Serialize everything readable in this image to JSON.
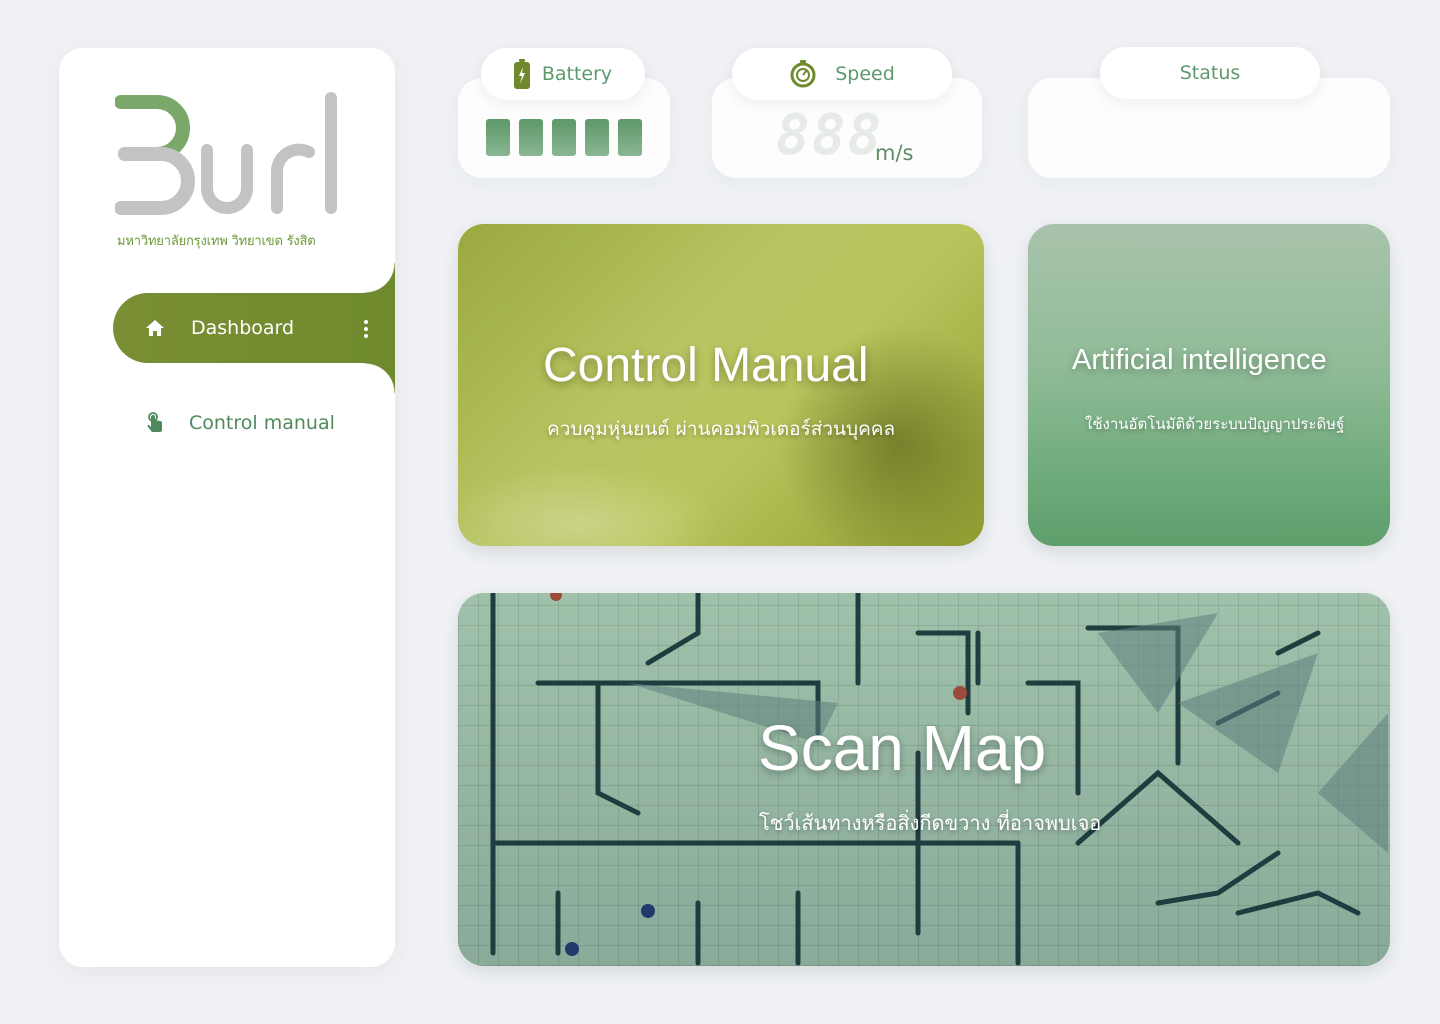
{
  "sidebar": {
    "university": "มหาวิทยาลัยกรุงเทพ วิทยาเขต รังสิต",
    "logo_icon": "burl-logo",
    "items": [
      {
        "label": "Dashboard",
        "icon": "home-icon",
        "active": true
      },
      {
        "label": "Control manual",
        "icon": "tap-icon",
        "active": false
      }
    ]
  },
  "widgets": {
    "battery": {
      "label": "Battery",
      "icon": "battery-icon",
      "level_bars": 5
    },
    "speed": {
      "label": "Speed",
      "icon": "speedometer-icon",
      "value": "888",
      "unit": "m/s"
    },
    "status": {
      "label": "Status",
      "value": ""
    }
  },
  "cards": {
    "control": {
      "title": "Control Manual",
      "subtitle": "ควบคุมหุ่นยนต์ ผ่านคอมพิวเตอร์ส่วนบุคคล"
    },
    "ai": {
      "title": "Artificial intelligence",
      "subtitle": "ใช้งานอัตโนมัติด้วยระบบปัญญาประดิษฐ์"
    },
    "map": {
      "title": "Scan Map",
      "subtitle": "โชว์เส้นทางหรือสิ่งกีดขวาง ที่อาจพบเจอ"
    }
  },
  "colors": {
    "accent_olive": "#6f8a2d",
    "accent_green": "#5c9a6c",
    "background": "#eff1f4"
  }
}
